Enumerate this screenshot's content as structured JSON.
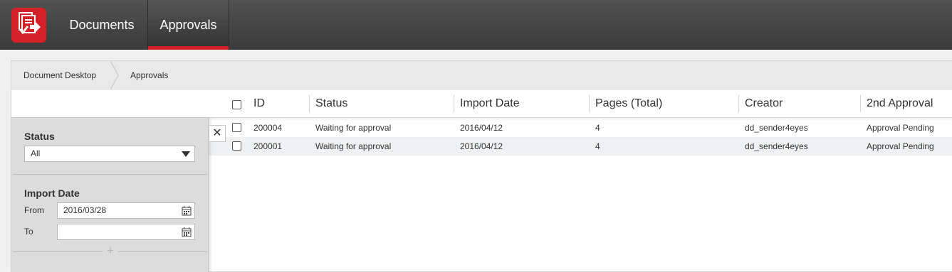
{
  "nav": {
    "documents": "Documents",
    "approvals": "Approvals"
  },
  "breadcrumb": [
    "Document Desktop",
    "Approvals"
  ],
  "table": {
    "headers": [
      "ID",
      "Status",
      "Import Date",
      "Pages (Total)",
      "Creator",
      "2nd Approval"
    ],
    "rows": [
      [
        "200004",
        "Waiting for approval",
        "2016/04/12",
        "4",
        "dd_sender4eyes",
        "Approval Pending"
      ],
      [
        "200001",
        "Waiting for approval",
        "2016/04/12",
        "4",
        "dd_sender4eyes",
        "Approval Pending"
      ]
    ]
  },
  "filter": {
    "status_label": "Status",
    "status_value": "All",
    "import_date_label": "Import Date",
    "from_label": "From",
    "from_value": "2016/03/28",
    "to_label": "To",
    "to_value": "",
    "add_symbol": "+",
    "close_symbol": "✕"
  },
  "colors": {
    "accent": "#d42027",
    "topbar": "#444444",
    "row_alt": "#eef0f2"
  }
}
